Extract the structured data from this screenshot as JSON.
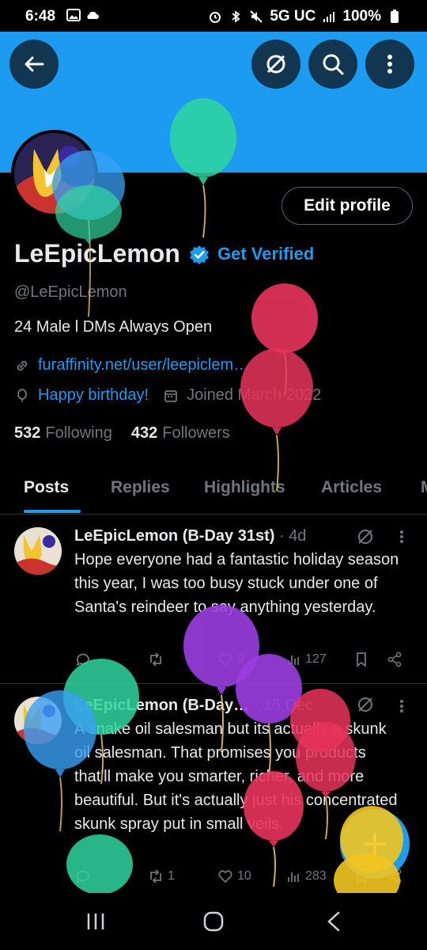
{
  "status_bar": {
    "time": "6:48",
    "network": "5G UC",
    "battery": "100%"
  },
  "header": {
    "back_icon": "arrow-left-icon",
    "grok_icon": "grok-icon",
    "search_icon": "search-icon",
    "more_icon": "more-vertical-icon",
    "banner_color": "#1d9bf0"
  },
  "profile": {
    "name": "LeEpicLemon",
    "get_verified": "Get Verified",
    "handle": "@LeEpicLemon",
    "bio": "24 Male l DMs Always Open",
    "link": "furaffinity.net/user/leepiclem…",
    "birthday": "Happy birthday!",
    "joined": "Joined March 2022",
    "following_count": "532",
    "following_label": "Following",
    "followers_count": "432",
    "followers_label": "Followers",
    "edit_profile": "Edit profile"
  },
  "tabs": {
    "items": [
      "Posts",
      "Replies",
      "Highlights",
      "Articles",
      "M"
    ],
    "active": "Posts"
  },
  "tweets": [
    {
      "author": "LeEpicLemon (B-Day 31st)",
      "dot": "·",
      "time": "4d",
      "text": "Hope everyone had a fantastic holiday season this year, I was too busy stuck under one of Santa's reindeer to say anything yesterday.",
      "likes": "9",
      "views": "127"
    },
    {
      "author": "LeEpicLemon (B-Day…",
      "dot": "·",
      "time": "15 Dec",
      "text": "A snake oil salesman but its actually a skunk oil salesman. That promises you products that'll make you smarter, richer, and more beautiful. But it's actually just his concentrated skunk spray put in small veils.",
      "retweets": "1",
      "likes": "10",
      "views": "283"
    }
  ],
  "colors": {
    "accent": "#1d9bf0",
    "muted": "#71767b",
    "divider": "#2f3336",
    "balloon_green": "#2fd6a0",
    "balloon_blue": "#3aa0f5",
    "balloon_red": "#e8345c",
    "balloon_purple": "#9b3ee0",
    "balloon_yellow": "#f2c520"
  }
}
